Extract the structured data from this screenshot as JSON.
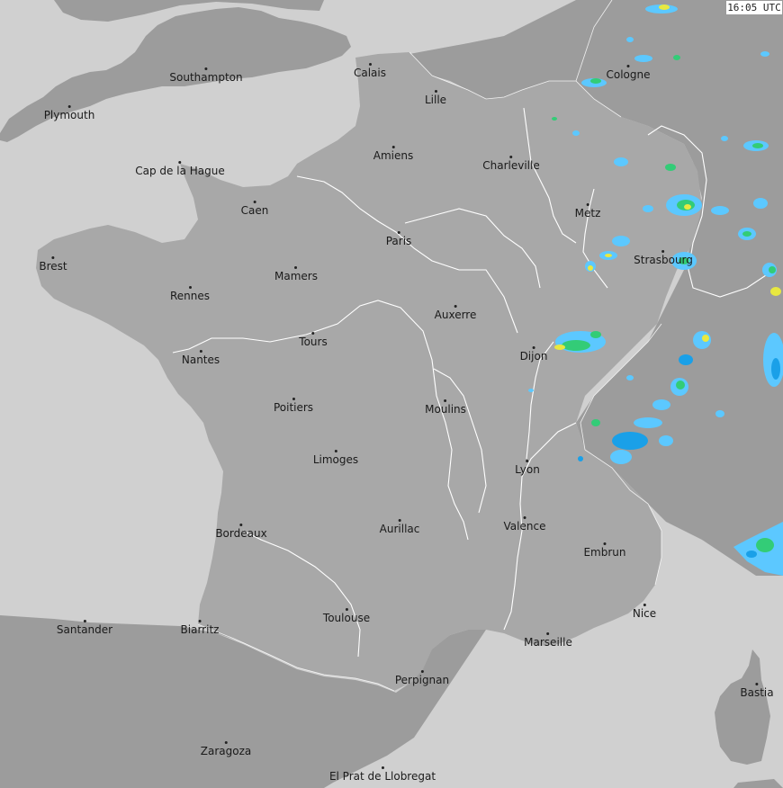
{
  "map": {
    "timestamp": "16:05 UTC",
    "cities": [
      {
        "id": "southampton",
        "name": "Southampton"
      },
      {
        "id": "calais",
        "name": "Calais"
      },
      {
        "id": "cologne",
        "name": "Cologne"
      },
      {
        "id": "plymouth",
        "name": "Plymouth"
      },
      {
        "id": "lille",
        "name": "Lille"
      },
      {
        "id": "amiens",
        "name": "Amiens"
      },
      {
        "id": "charleville",
        "name": "Charleville"
      },
      {
        "id": "cap-de-la-hague",
        "name": "Cap de la Hague"
      },
      {
        "id": "caen",
        "name": "Caen"
      },
      {
        "id": "metz",
        "name": "Metz"
      },
      {
        "id": "paris",
        "name": "Paris"
      },
      {
        "id": "strasbourg",
        "name": "Strasbourg"
      },
      {
        "id": "brest",
        "name": "Brest"
      },
      {
        "id": "mamers",
        "name": "Mamers"
      },
      {
        "id": "rennes",
        "name": "Rennes"
      },
      {
        "id": "auxerre",
        "name": "Auxerre"
      },
      {
        "id": "tours",
        "name": "Tours"
      },
      {
        "id": "dijon",
        "name": "Dijon"
      },
      {
        "id": "nantes",
        "name": "Nantes"
      },
      {
        "id": "poitiers",
        "name": "Poitiers"
      },
      {
        "id": "moulins",
        "name": "Moulins"
      },
      {
        "id": "limoges",
        "name": "Limoges"
      },
      {
        "id": "lyon",
        "name": "Lyon"
      },
      {
        "id": "valence",
        "name": "Valence"
      },
      {
        "id": "bordeaux",
        "name": "Bordeaux"
      },
      {
        "id": "aurillac",
        "name": "Aurillac"
      },
      {
        "id": "embrun",
        "name": "Embrun"
      },
      {
        "id": "nice",
        "name": "Nice"
      },
      {
        "id": "toulouse",
        "name": "Toulouse"
      },
      {
        "id": "santander",
        "name": "Santander"
      },
      {
        "id": "biarritz",
        "name": "Biarritz"
      },
      {
        "id": "marseille",
        "name": "Marseille"
      },
      {
        "id": "perpignan",
        "name": "Perpignan"
      },
      {
        "id": "bastia",
        "name": "Bastia"
      },
      {
        "id": "zaragoza",
        "name": "Zaragoza"
      },
      {
        "id": "el-prat",
        "name": "El Prat de Llobregat"
      }
    ],
    "colors": {
      "sea": "#d0d0d0",
      "france": "#a8a8a8",
      "neighbors": "#9c9c9c",
      "rivers": "#ffffff",
      "radar_light": "#5cc8ff",
      "radar_mid": "#1aa0e8",
      "radar_green": "#33cc77",
      "radar_yellow": "#e8e840"
    }
  }
}
